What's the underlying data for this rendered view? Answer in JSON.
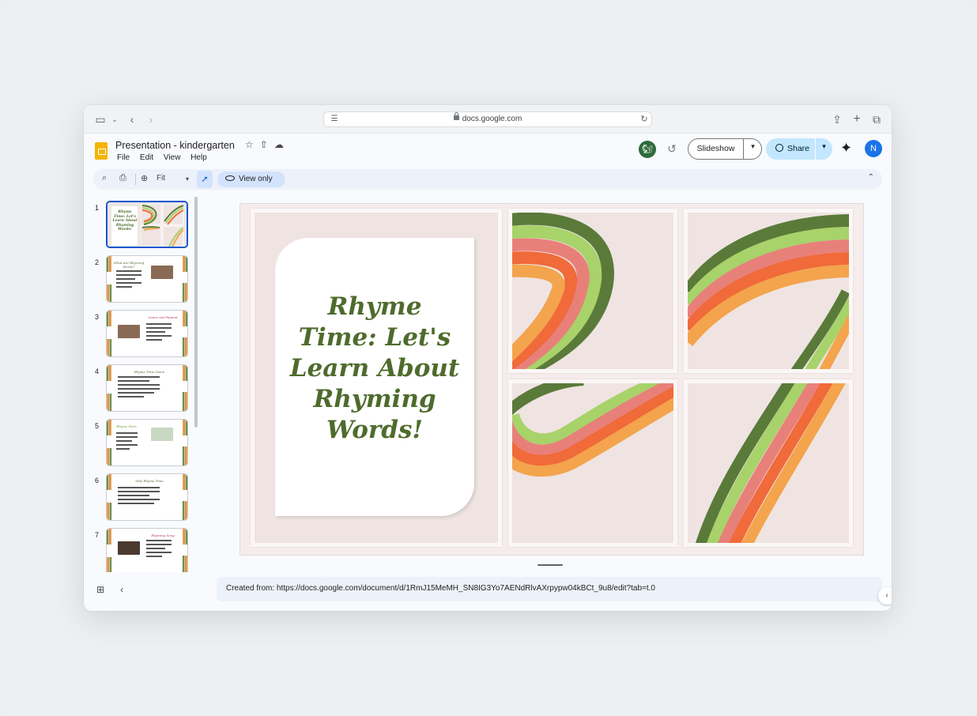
{
  "browser": {
    "url": "docs.google.com"
  },
  "app": {
    "title": "Presentation - kindergarten",
    "menu": [
      "File",
      "Edit",
      "View",
      "Help"
    ],
    "slideshow_label": "Slideshow",
    "share_label": "Share",
    "user_initial": "N"
  },
  "toolbar": {
    "zoom": "Fit",
    "view_only": "View only"
  },
  "filmstrip": {
    "slides": [
      {
        "num": "1"
      },
      {
        "num": "2",
        "title": "What Are Rhyming Words?"
      },
      {
        "num": "3",
        "title": "Listen and Repeat"
      },
      {
        "num": "4",
        "title": "Rhyme Time Game"
      },
      {
        "num": "5",
        "title": "Rhyme Pairs"
      },
      {
        "num": "6",
        "title": "Silly Rhyme Time"
      },
      {
        "num": "7",
        "title": "Rhyming Song"
      }
    ]
  },
  "slide": {
    "title": "Rhyme Time: Let's Learn About Rhyming Words!"
  },
  "notes": {
    "text": "Created from: https://docs.google.com/document/d/1RmJ15MeMH_SN8IG3Yo7AENdRlvAXrpypw04kBCt_9u8/edit?tab=t.0"
  },
  "colors": {
    "stripe_dark_green": "#5a7a3a",
    "stripe_light_green": "#a8d26a",
    "stripe_pink": "#e8807a",
    "stripe_orange": "#f06a3a",
    "stripe_light_orange": "#f3a44c",
    "title_green": "#4e6b2c",
    "accent_blue": "#0b57d0"
  }
}
